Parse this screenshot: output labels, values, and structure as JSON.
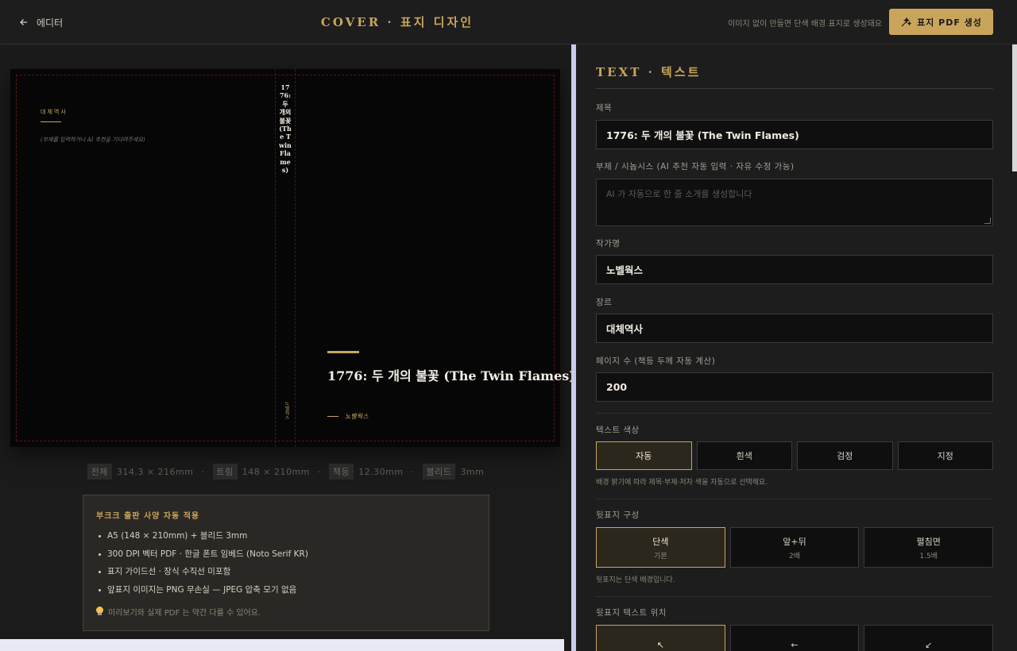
{
  "header": {
    "back_label": "에디터",
    "title": "COVER · 표지 디자인",
    "hint": "이미지 없이 만들면 단색 배경 표지로 생성돼요",
    "pdf_button": "표지 PDF 생성"
  },
  "cover": {
    "back_genre": "대체역사",
    "back_subtitle": "(부제를 입력하거나 AI 추천을 기다려주세요)",
    "spine_title": "1776: 두 개의 불꽃 (The Twin Flames)",
    "spine_author": "노벨웍스",
    "front_title": "1776: 두 개의 불꽃 (The Twin Flames)",
    "front_author": "노벨웍스"
  },
  "specs": [
    {
      "label": "전체",
      "value": "314.3 × 216mm"
    },
    {
      "label": "트림",
      "value": "148 × 210mm"
    },
    {
      "label": "책등",
      "value": "12.30mm"
    },
    {
      "label": "블리드",
      "value": "3mm"
    }
  ],
  "info": {
    "title": "부크크 출판 사양 자동 적용",
    "items": [
      "A5 (148 × 210mm) + 블리드 3mm",
      "300 DPI 벡터 PDF · 한글 폰트 임베드 (Noto Serif KR)",
      "표지 가이드선 · 장식 수직선 미포함",
      "앞표지 이미지는 PNG 무손실 — JPEG 압축 모기 없음"
    ],
    "note": "미리보기와 실제 PDF 는 약간 다를 수 있어요."
  },
  "panel": {
    "section_title": "TEXT · 텍스트",
    "title_label": "제목",
    "title_value": "1776: 두 개의 불꽃 (The Twin Flames)",
    "subtitle_label": "부제 / 시놉시스 (AI 추천 자동 입력 · 자유 수정 가능)",
    "subtitle_placeholder": "AI 가 자동으로 한 줄 소개를 생성합니다",
    "author_label": "작가명",
    "author_value": "노벨웍스",
    "genre_label": "장르",
    "genre_value": "대체역사",
    "pages_label": "페이지 수 (책등 두께 자동 계산)",
    "pages_value": "200",
    "text_color_label": "텍스트 색상",
    "text_color_options": [
      "자동",
      "흰색",
      "검정",
      "지정"
    ],
    "text_color_hint": "배경 밝기에 따라 제목·부제·저자 색을 자동으로 선택해요.",
    "back_layout_label": "뒷표지 구성",
    "back_layout_options": [
      {
        "label": "단색",
        "sub": "기본"
      },
      {
        "label": "앞+뒤",
        "sub": "2배"
      },
      {
        "label": "펼침면",
        "sub": "1.5배"
      }
    ],
    "back_layout_hint": "뒷표지는 단색 배경입니다.",
    "back_text_pos_label": "뒷표지 텍스트 위치",
    "back_text_pos_options": [
      "↖",
      "←",
      "↙"
    ]
  }
}
